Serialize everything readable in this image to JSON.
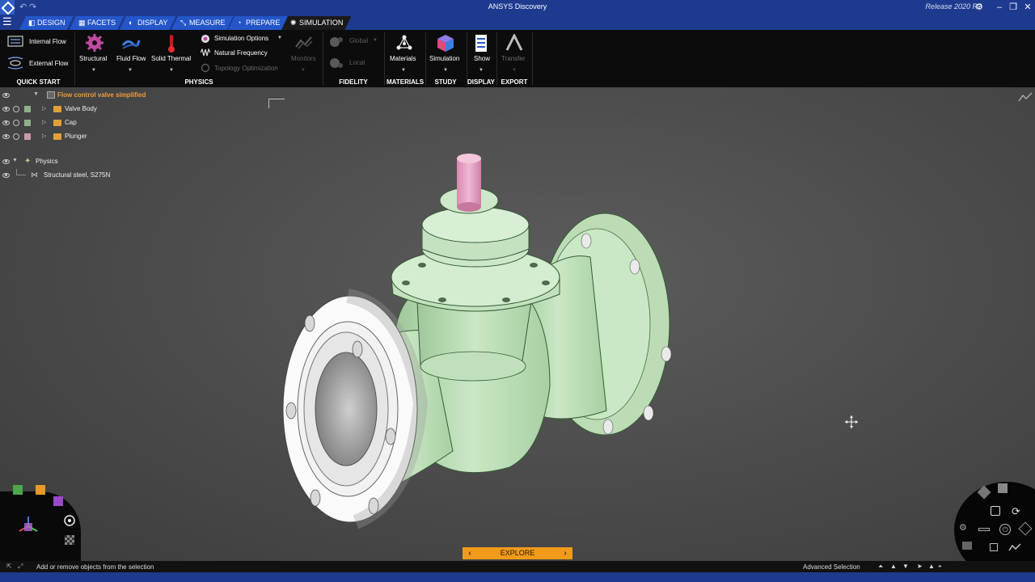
{
  "window": {
    "title": "ANSYS Discovery",
    "release": "Release 2020 R2"
  },
  "tabs": [
    {
      "label": "Design"
    },
    {
      "label": "Facets"
    },
    {
      "label": "Display"
    },
    {
      "label": "Measure"
    },
    {
      "label": "Prepare"
    },
    {
      "label": "Simulation"
    }
  ],
  "ribbon": {
    "quick_start": {
      "label": "Quick Start",
      "internal_flow": "Internal Flow",
      "external_flow": "External Flow"
    },
    "physics": {
      "label": "Physics",
      "structural": "Structural",
      "fluid_flow": "Fluid Flow",
      "solid_thermal": "Solid Thermal",
      "simulation_options": "Simulation Options",
      "natural_frequency": "Natural Frequency",
      "topology_optimization": "Topology Optimization",
      "monitors": "Monitors"
    },
    "fidelity": {
      "label": "Fidelity",
      "global": "Global",
      "local": "Local"
    },
    "materials": {
      "label": "Materials",
      "button": "Materials"
    },
    "study": {
      "label": "Study",
      "button": "Simulation"
    },
    "display": {
      "label": "Display",
      "button": "Show"
    },
    "export": {
      "label": "Export",
      "button": "Transfer"
    }
  },
  "tree": {
    "root": "Flow control valve simplified",
    "items": [
      {
        "label": "Valve Body",
        "color": "#8fb08a"
      },
      {
        "label": "Cap",
        "color": "#8fb08a"
      },
      {
        "label": "Plunger",
        "color": "#c89aa8"
      }
    ],
    "physics": "Physics",
    "material": "Structural steel, S275N"
  },
  "statusbar": {
    "hint": "Add or remove objects from the selection",
    "mode": "Advanced Selection"
  },
  "explore": {
    "label": "Explore"
  },
  "colors": {
    "accent_blue": "#1d3a8f",
    "tab_blue": "#2456c9",
    "part_green": "#c9e8c4",
    "plunger_pink": "#e7a8c8",
    "explore_orange": "#f19a1b",
    "tree_root_orange": "#f39c3a"
  }
}
